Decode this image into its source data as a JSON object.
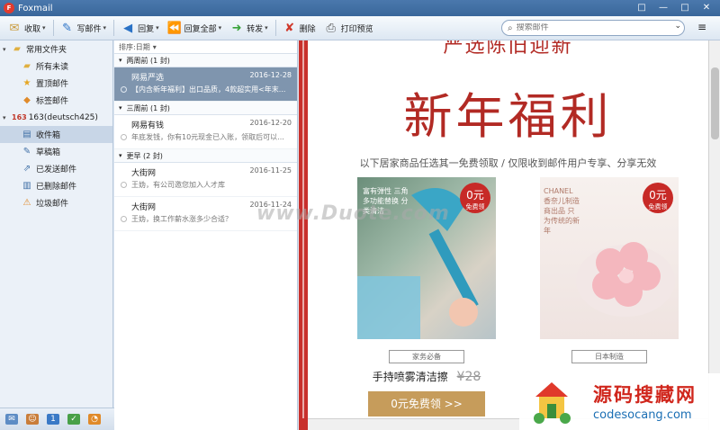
{
  "window": {
    "title": "Foxmail",
    "controls": [
      "□",
      "—",
      "□",
      "✕"
    ]
  },
  "toolbar": {
    "receive": "收取",
    "compose": "写邮件",
    "reply": "回复",
    "reply_all": "回复全部",
    "forward": "转发",
    "delete": "删除",
    "print_preview": "打印预览",
    "search_placeholder": "搜索邮件",
    "menu_icon": "≡"
  },
  "sidebar": {
    "common_folders": "常用文件夹",
    "common_items": [
      "所有未读",
      "置顶邮件",
      "标签邮件"
    ],
    "account_num": "163",
    "account_name": "163(deutsch425)",
    "account_items": [
      "收件箱",
      "草稿箱",
      "已发送邮件",
      "已删除邮件",
      "垃圾邮件"
    ]
  },
  "maillist": {
    "sort_label": "排序:日期",
    "groups": [
      {
        "label": "两周前 (1 封)"
      },
      {
        "label": "三周前 (1 封)"
      },
      {
        "label": "更早 (2 封)"
      }
    ],
    "mails": [
      {
        "sender": "网易严选",
        "date": "2016-12-28",
        "preview": "【内含新年福利】出口品质，4款超实用<年末..."
      },
      {
        "sender": "网易有钱",
        "date": "2016-12-20",
        "preview": "年底发钱，你有10元现金已入账，领取后可以..."
      },
      {
        "sender": "大街网",
        "date": "2016-11-25",
        "preview": "王妫，有公司邀您加入人才库"
      },
      {
        "sender": "大街网",
        "date": "2016-11-24",
        "preview": "王妫，换工作薪水涨多少合适？"
      }
    ]
  },
  "preview": {
    "top_text": "严选陈旧迎新",
    "title": "新年福利",
    "subtitle": "以下居家商品任选其一免费领取 / 仅限收到邮件用户专享、分享无效",
    "products": [
      {
        "badge_price": "0元",
        "badge_label": "免费领",
        "img_text": "富有弹性 三角多功能替换 分类清洁",
        "tag": "家务必备",
        "name": "手持喷雾清洁擦",
        "orig_price": "¥28",
        "cta": "0元免费领 >>"
      },
      {
        "badge_price": "0元",
        "badge_label": "免费领",
        "img_text": "CHANEL香奈儿制造商出品 只为传统的新年",
        "tag": "日本制造",
        "name": "",
        "orig_price": "",
        "cta": ""
      }
    ]
  },
  "watermark": {
    "center": "www.Duote.com",
    "brand": "源码搜藏网",
    "url": "codesocang.com"
  }
}
